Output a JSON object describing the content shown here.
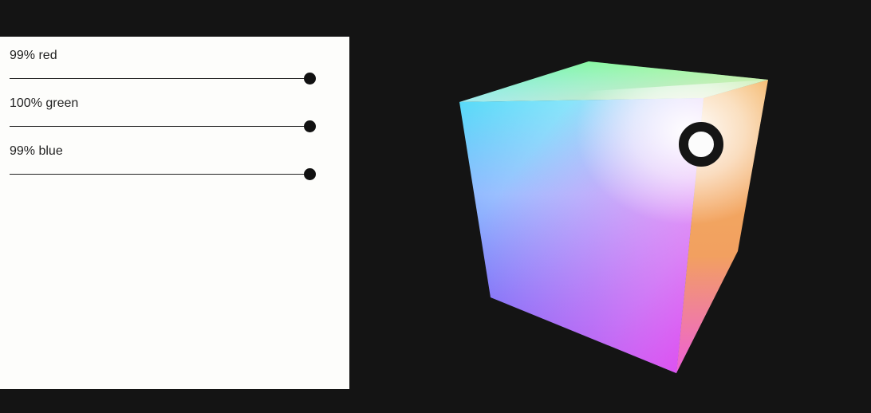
{
  "controls": {
    "sliders": [
      {
        "label": "99% red",
        "value": 0.99,
        "color": "#ff0000"
      },
      {
        "label": "100% green",
        "value": 1.0,
        "color": "#00ff00"
      },
      {
        "label": "99% blue",
        "value": 0.99,
        "color": "#0000ff"
      }
    ]
  },
  "cube": {
    "selected_color": "#fcfcfc",
    "marker_icon": "ring-marker-icon",
    "faces": {
      "top": [
        "#5ce6ff",
        "#78ff66",
        "#e8ffd8",
        "#ffd19a"
      ],
      "front": [
        "#58dbf8",
        "#f4f4ff",
        "#e640f2",
        "#5050f8"
      ],
      "right": [
        "#f4f0e8",
        "#f4b25e",
        "#f0a070",
        "#ee55e8"
      ]
    }
  }
}
